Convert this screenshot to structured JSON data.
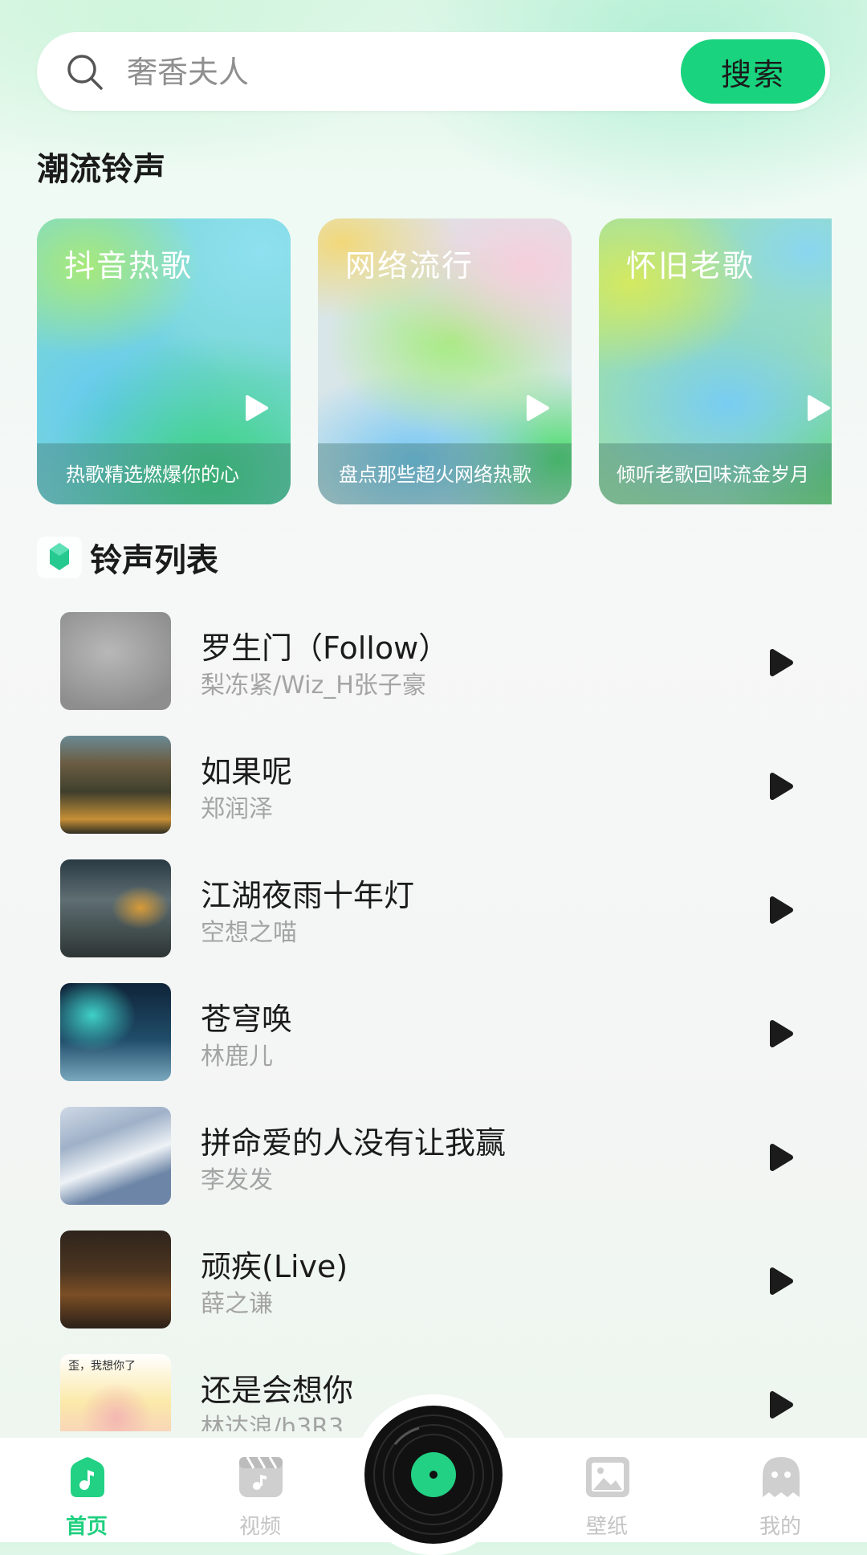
{
  "search": {
    "placeholder": "奢香夫人",
    "button_label": "搜索"
  },
  "trending": {
    "title": "潮流铃声",
    "cards": [
      {
        "title": "抖音热歌",
        "subtitle": "热歌精选燃爆你的心"
      },
      {
        "title": "网络流行",
        "subtitle": "盘点那些超火网络热歌"
      },
      {
        "title": "怀旧老歌",
        "subtitle": "倾听老歌回味流金岁月"
      }
    ]
  },
  "ringtones": {
    "title": "铃声列表",
    "songs": [
      {
        "title": "罗生门（Follow）",
        "artist": "梨冻紧/Wiz_H张子豪"
      },
      {
        "title": "如果呢",
        "artist": "郑润泽"
      },
      {
        "title": "江湖夜雨十年灯",
        "artist": "空想之喵"
      },
      {
        "title": "苍穹唤",
        "artist": "林鹿儿"
      },
      {
        "title": "拼命爱的人没有让我赢",
        "artist": "李发发"
      },
      {
        "title": "顽疾(Live)",
        "artist": "薛之谦"
      },
      {
        "title": "还是会想你",
        "artist": "林达浪/h3R3",
        "thumb_text": "歪，我想你了"
      }
    ]
  },
  "nav": {
    "home": "首页",
    "video": "视频",
    "wallpaper": "壁纸",
    "mine": "我的"
  },
  "colors": {
    "accent": "#19d37e",
    "nav_active": "#1fcf7f",
    "nav_inactive": "#c4c4c4"
  },
  "icons": {
    "search": "search-icon",
    "play": "play-icon",
    "list_header": "ringtone-list-icon",
    "home": "music-note-icon",
    "video": "film-icon",
    "wallpaper": "image-icon",
    "mine": "ghost-icon",
    "center": "vinyl-record-icon"
  }
}
